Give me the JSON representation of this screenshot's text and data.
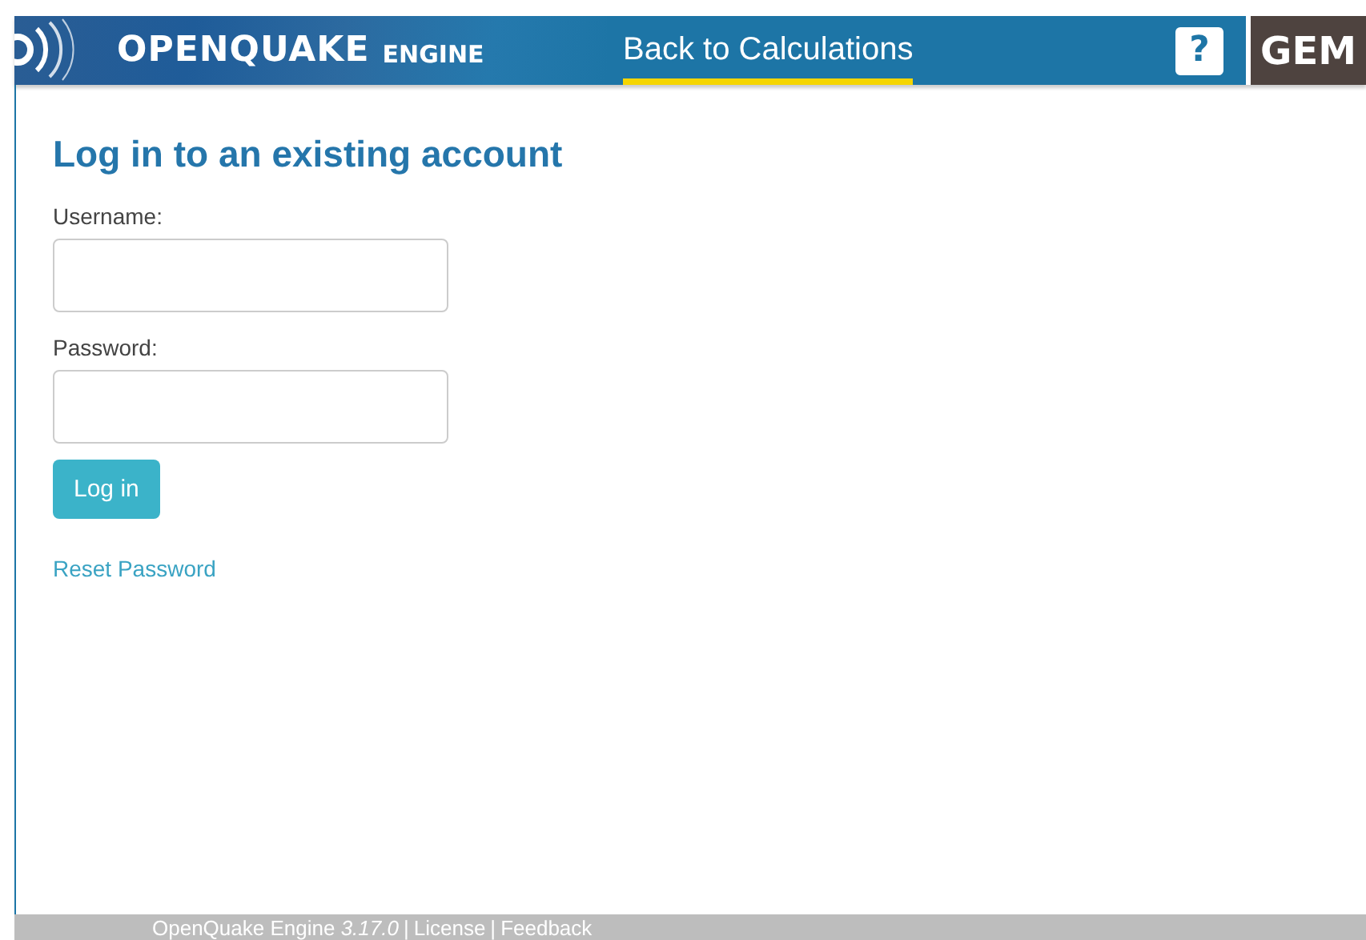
{
  "header": {
    "logo_main": "OPENQUAKE",
    "logo_sub": "ENGINE",
    "nav": [
      {
        "label": "Back to Calculations",
        "selected": true
      }
    ],
    "help": "?",
    "partner": "GEM"
  },
  "login": {
    "title": "Log in to an existing account",
    "fields": [
      {
        "label": "Username:"
      },
      {
        "label": "Password:"
      }
    ],
    "button": "Log in",
    "reset_link": "Reset Password"
  },
  "footer": [
    {
      "kind": "text",
      "text": "OpenQuake Engine *3.17.0*"
    },
    {
      "kind": "separator",
      "text": "|"
    },
    {
      "kind": "link",
      "text": "License"
    },
    {
      "kind": "separator",
      "text": "|"
    },
    {
      "kind": "link",
      "text": "Feedback"
    }
  ]
}
